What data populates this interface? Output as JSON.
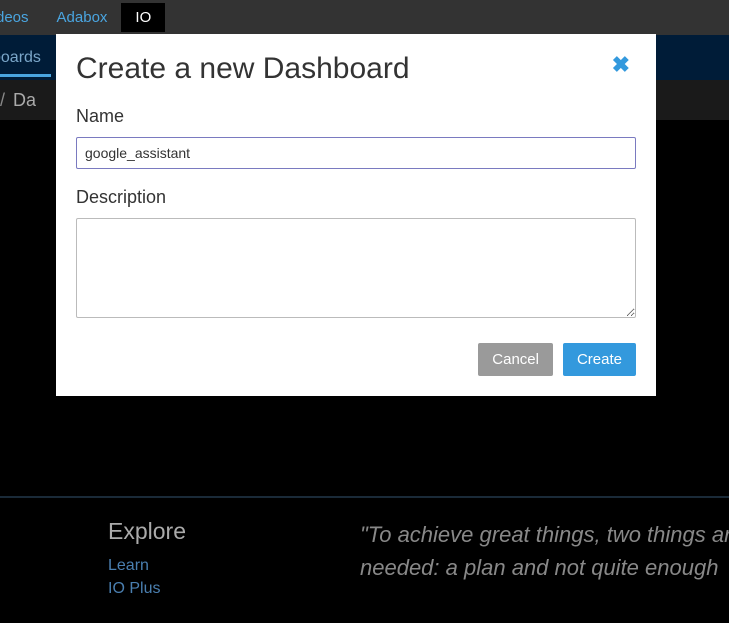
{
  "top_tabs": {
    "videos": "deos",
    "adabox": "Adabox",
    "io": "IO"
  },
  "sec_nav": {
    "dashboards": "boards"
  },
  "breadcrumb": {
    "partial": "",
    "item": "Da"
  },
  "modal": {
    "title": "Create a new Dashboard",
    "name_label": "Name",
    "name_value": "google_assistant",
    "description_label": "Description",
    "description_value": "",
    "cancel": "Cancel",
    "create": "Create"
  },
  "footer": {
    "explore_heading": "Explore",
    "links": {
      "learn": "Learn",
      "ioplus": "IO Plus"
    },
    "quote": "\"To achieve great things, two things are needed: a plan and not quite enough"
  },
  "colors": {
    "link_blue": "#4aa5e0",
    "modal_accent": "#3399dd",
    "input_border": "#7a7ac0"
  }
}
